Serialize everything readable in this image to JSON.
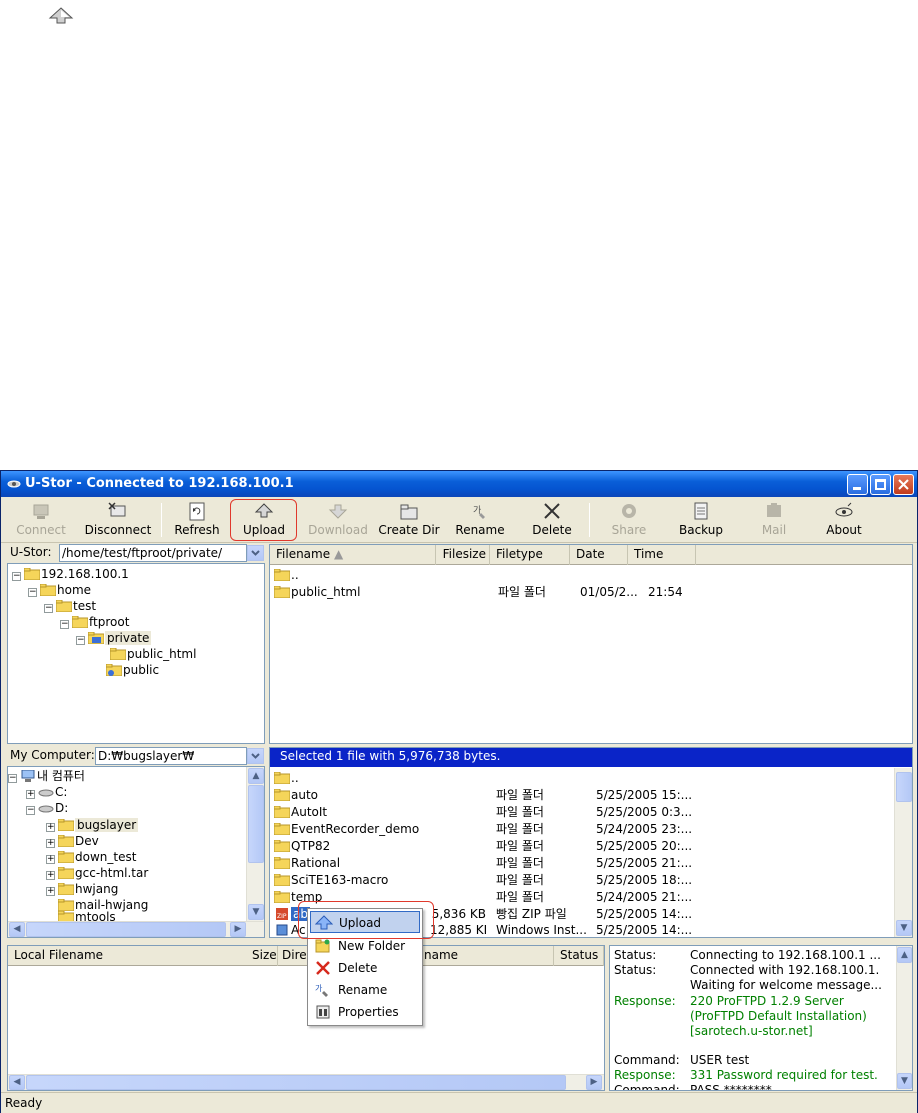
{
  "window": {
    "title": "U-Stor - Connected to 192.168.100.1"
  },
  "toolbar": {
    "connect": "Connect",
    "disconnect": "Disconnect",
    "refresh": "Refresh",
    "upload": "Upload",
    "download": "Download",
    "create_dir": "Create Dir",
    "rename": "Rename",
    "delete": "Delete",
    "share": "Share",
    "backup": "Backup",
    "mail": "Mail",
    "about": "About"
  },
  "remote": {
    "label": "U-Stor:",
    "path": "/home/test/ftproot/private/",
    "tree": [
      {
        "label": "192.168.100.1"
      },
      {
        "label": "home"
      },
      {
        "label": "test"
      },
      {
        "label": "ftproot"
      },
      {
        "label": "private"
      },
      {
        "label": "public_html"
      },
      {
        "label": "public"
      }
    ],
    "columns": [
      "Filename",
      "Filesize",
      "Filetype",
      "Date",
      "Time"
    ],
    "files": [
      {
        "name": "..",
        "size": "",
        "type": "",
        "date": "",
        "time": ""
      },
      {
        "name": "public_html",
        "size": "",
        "type": "파일 폴더",
        "date": "01/05/2...",
        "time": "21:54"
      }
    ]
  },
  "local": {
    "label": "My Computer:",
    "path": "D:₩bugslayer₩",
    "tree": [
      {
        "label": "내 컴퓨터"
      },
      {
        "label": "C:"
      },
      {
        "label": "D:"
      },
      {
        "label": "bugslayer"
      },
      {
        "label": "Dev"
      },
      {
        "label": "down_test"
      },
      {
        "label": "gcc-html.tar"
      },
      {
        "label": "hwjang"
      },
      {
        "label": "mail-hwjang"
      },
      {
        "label": "mtools"
      }
    ],
    "banner": "Selected 1 file with 5,976,738 bytes.",
    "files": [
      {
        "name": "..",
        "size": "",
        "type": "",
        "date": ""
      },
      {
        "name": "auto",
        "size": "",
        "type": "파일 폴더",
        "date": "5/25/2005 15:..."
      },
      {
        "name": "AutoIt",
        "size": "",
        "type": "파일 폴더",
        "date": "5/25/2005 0:3..."
      },
      {
        "name": "EventRecorder_demo",
        "size": "",
        "type": "파일 폴더",
        "date": "5/24/2005 23:..."
      },
      {
        "name": "QTP82",
        "size": "",
        "type": "파일 폴더",
        "date": "5/25/2005 20:..."
      },
      {
        "name": "Rational",
        "size": "",
        "type": "파일 폴더",
        "date": "5/25/2005 21:..."
      },
      {
        "name": "SciTE163-macro",
        "size": "",
        "type": "파일 폴더",
        "date": "5/25/2005 18:..."
      },
      {
        "name": "temp",
        "size": "",
        "type": "파일 폴더",
        "date": "5/24/2005 21:..."
      },
      {
        "name": "ab",
        "size": "5,836 KB",
        "type": "빵집 ZIP 파일",
        "date": "5/25/2005 14:..."
      },
      {
        "name": "Ac",
        "size": "12,885 KB",
        "type": "Windows Inst...",
        "date": "5/25/2005 14:..."
      }
    ]
  },
  "queue": {
    "columns": [
      "Local Filename",
      "Size",
      "Dire",
      "name",
      "Status"
    ]
  },
  "log": [
    {
      "type": "Status:",
      "msg": "Connecting to 192.168.100.1 ...",
      "color": "#000000"
    },
    {
      "type": "Status:",
      "msg": "Connected with 192.168.100.1. Waiting for welcome message...",
      "color": "#000000"
    },
    {
      "type": "Response:",
      "msg": "220 ProFTPD 1.2.9 Server (ProFTPD Default Installation) [sarotech.u-stor.net]",
      "color": "#008000"
    },
    {
      "type": "Command:",
      "msg": "USER test",
      "color": "#000000"
    },
    {
      "type": "Response:",
      "msg": "331 Password required for test.",
      "color": "#008000"
    },
    {
      "type": "Command:",
      "msg": "PASS ********",
      "color": "#000000"
    }
  ],
  "context_menu": {
    "items": [
      {
        "label": "Upload"
      },
      {
        "label": "New Folder"
      },
      {
        "label": "Delete"
      },
      {
        "label": "Rename"
      },
      {
        "label": "Properties"
      }
    ]
  },
  "statusbar": {
    "text": "Ready"
  },
  "colors": {
    "title_blue": "#0554d0",
    "selection_blue": "#0a24c8",
    "highlight_red": "#e0392c",
    "folder_yellow": "#f5d55a"
  }
}
